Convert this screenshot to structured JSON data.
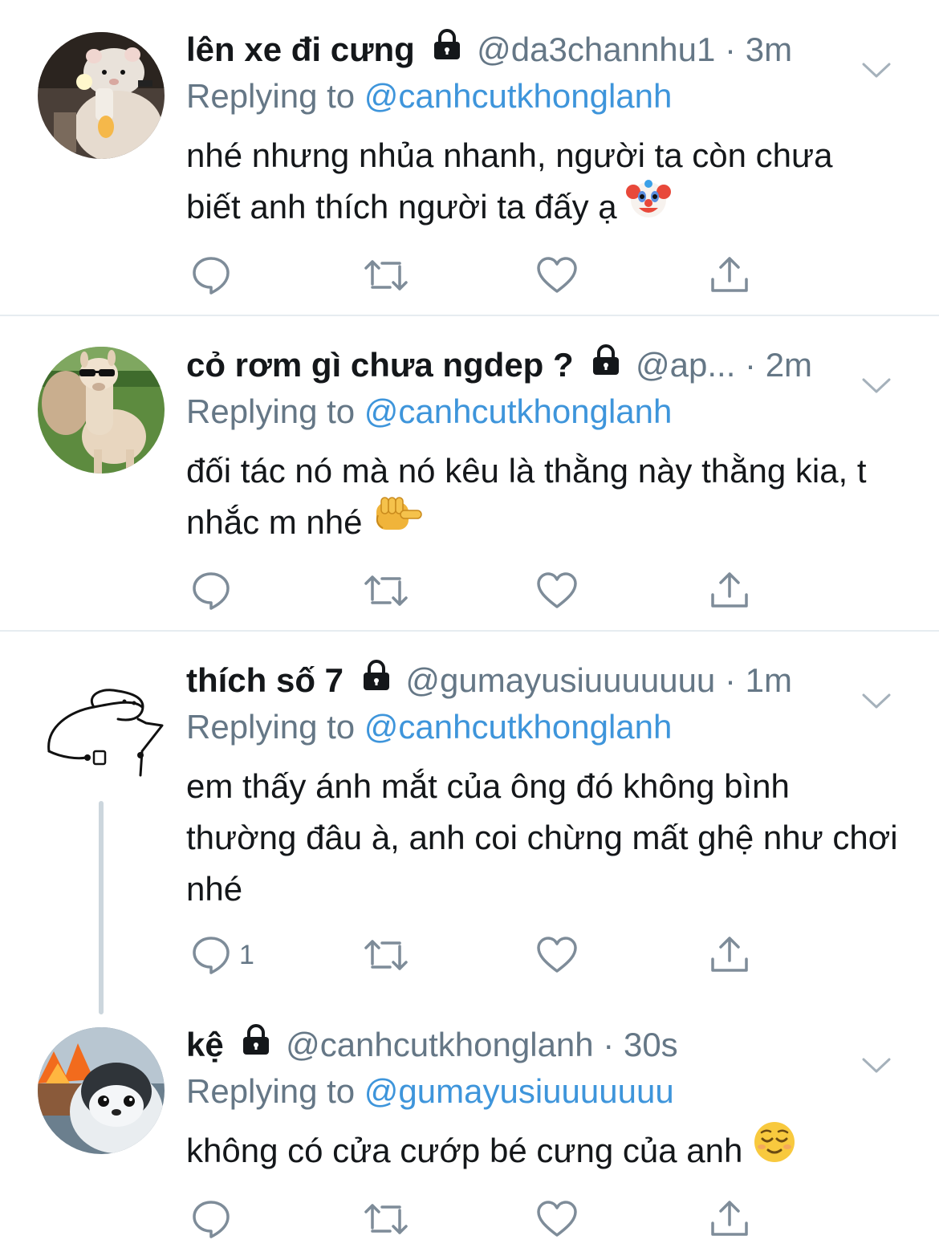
{
  "replying_label": "Replying to",
  "tweets": [
    {
      "name": "lên xe đi cưng",
      "handle": "@da3channhu1",
      "time": "3m",
      "replying_to": "@canhcutkhonglanh",
      "text": "nhé nhưng nhủa nhanh, người ta còn chưa biết anh thích người ta đấy ạ",
      "emoji": "clown-face-emoji",
      "reply_count": "",
      "avatar": "hamster-avatar"
    },
    {
      "name": "cỏ rơm gì chưa ngdep ?",
      "handle": "@ap...",
      "time": "2m",
      "replying_to": "@canhcutkhonglanh",
      "text": "đối tác nó mà nó kêu là thằng này thằng kia, t nhắc m nhé",
      "emoji": "backhand-index-pointing-emoji",
      "reply_count": "",
      "avatar": "alpaca-avatar"
    },
    {
      "name": "thích số 7",
      "handle": "@gumayusiuuuuuuu",
      "time": "1m",
      "replying_to": "@canhcutkhonglanh",
      "text": "em thấy ánh mắt của ông đó không bình thường đâu à, anh coi chừng mất ghệ như chơi nhé",
      "emoji": "",
      "reply_count": "1",
      "avatar": "doodle-avatar"
    },
    {
      "name": "kệ",
      "handle": "@canhcutkhonglanh",
      "time": "30s",
      "replying_to": "@gumayusiuuuuuuu",
      "text": "không có cửa cướp bé cưng của anh",
      "emoji": "relieved-face-emoji",
      "reply_count": "",
      "avatar": "penguin-avatar"
    }
  ],
  "colors": {
    "link": "#3e95db",
    "muted": "#657786",
    "text": "#14171a",
    "divider": "#e6ecf0"
  }
}
